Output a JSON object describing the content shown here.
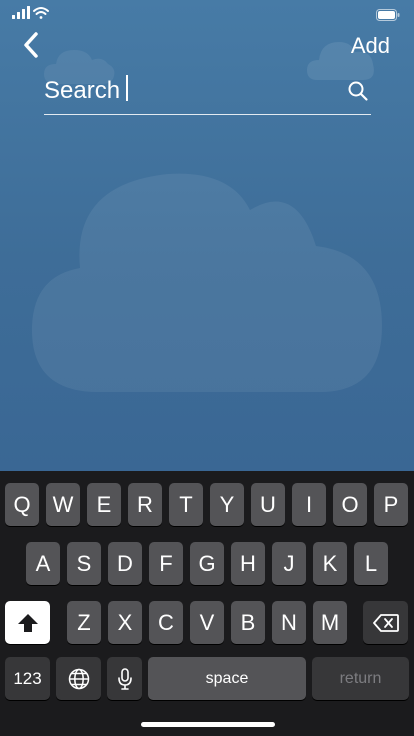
{
  "nav": {
    "back_icon": "chevron-left-icon",
    "add_label": "Add"
  },
  "search": {
    "placeholder": "Search",
    "value": "",
    "icon": "search-icon"
  },
  "status_bar": {
    "icons": [
      "signal-icon",
      "wifi-icon",
      "battery-icon"
    ]
  },
  "keyboard": {
    "row1": [
      "Q",
      "W",
      "E",
      "R",
      "T",
      "Y",
      "U",
      "I",
      "O",
      "P"
    ],
    "row2": [
      "A",
      "S",
      "D",
      "F",
      "G",
      "H",
      "J",
      "K",
      "L"
    ],
    "row3": [
      "Z",
      "X",
      "C",
      "V",
      "B",
      "N",
      "M"
    ],
    "numbers_label": "123",
    "space_label": "space",
    "return_label": "return"
  },
  "colors": {
    "background_top": "#477ba6",
    "background_bottom": "#3a6794",
    "keyboard_bg": "#1b1b1d",
    "key_bg": "#545457",
    "key_mod_bg": "#373739"
  }
}
